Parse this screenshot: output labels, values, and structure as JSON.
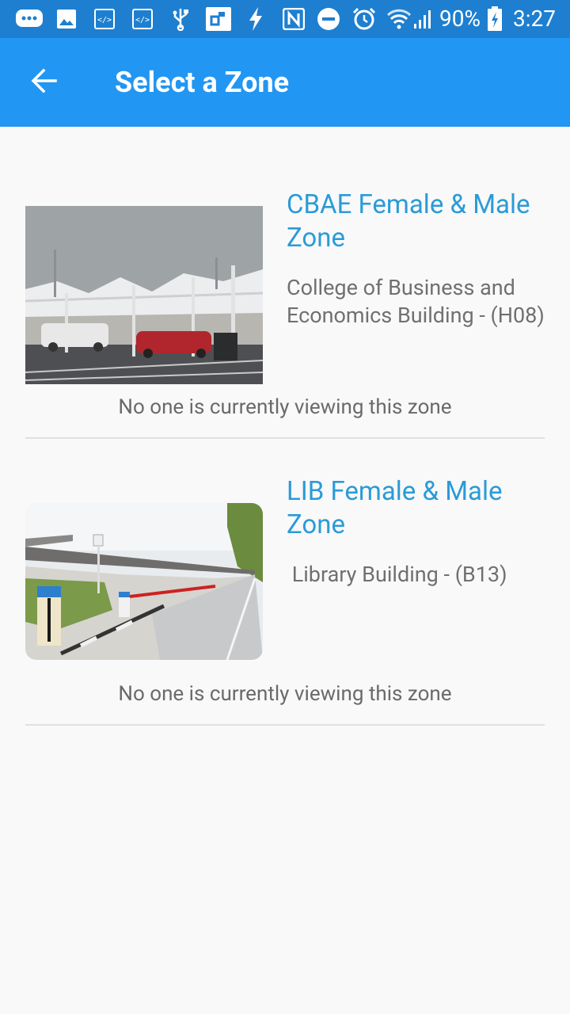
{
  "status_bar": {
    "battery": "90%",
    "time": "3:27",
    "icons": [
      "message-icon",
      "image-icon",
      "code-icon",
      "code-icon",
      "usb-icon",
      "cast-icon",
      "flash-icon",
      "nfc-icon",
      "dnd-icon",
      "alarm-icon",
      "wifi-icon",
      "signal-icon",
      "battery-charging-icon"
    ]
  },
  "app_bar": {
    "title": "Select a Zone",
    "back_icon": "arrow-back-icon",
    "color": "#2196f3"
  },
  "zones": [
    {
      "title": "CBAE Female & Male Zone",
      "subtitle": "College of Business and Economics Building - (H08)",
      "status": "No one is currently viewing this zone"
    },
    {
      "title": "LIB Female & Male Zone",
      "subtitle": " Library Building - (B13)",
      "status": "No one is currently viewing this zone"
    }
  ]
}
